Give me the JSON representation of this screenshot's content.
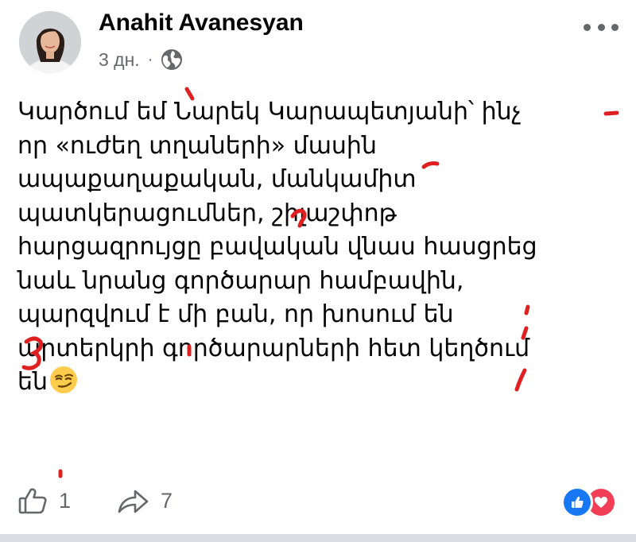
{
  "post": {
    "author": "Anahit Avanesyan",
    "time": "3 дн.",
    "separator": "·",
    "privacy_icon": "globe-icon",
    "menu_icon": "more-horizontal-icon",
    "lines": [
      "Կարծում եմ Նարեկ Կարապետյանի՝ ինչ",
      "որ «ուժեղ տղաների» մասին",
      "ապաքաղաքական, մանկամիտ",
      "պատկերացումներ, շիլաշփոթ",
      "հարցազրույցը բավական վնաս հասցրեց",
      "նաև նրանց գործարար համբավին,",
      "պարզվում է մի բան, որ խոսում են",
      "արտերկրի գործարարների հետ կեղծում",
      "են"
    ],
    "emoji": "smirk-face-emoji",
    "annotation_color": "#e02020"
  },
  "footer": {
    "like_icon": "thumbs-up-icon",
    "like_count": "1",
    "share_icon": "share-arrow-icon",
    "share_count": "7",
    "reactions": [
      "like-reaction-icon",
      "love-reaction-icon"
    ],
    "like_color": "#1877f2",
    "love_color": "#f33e58"
  }
}
